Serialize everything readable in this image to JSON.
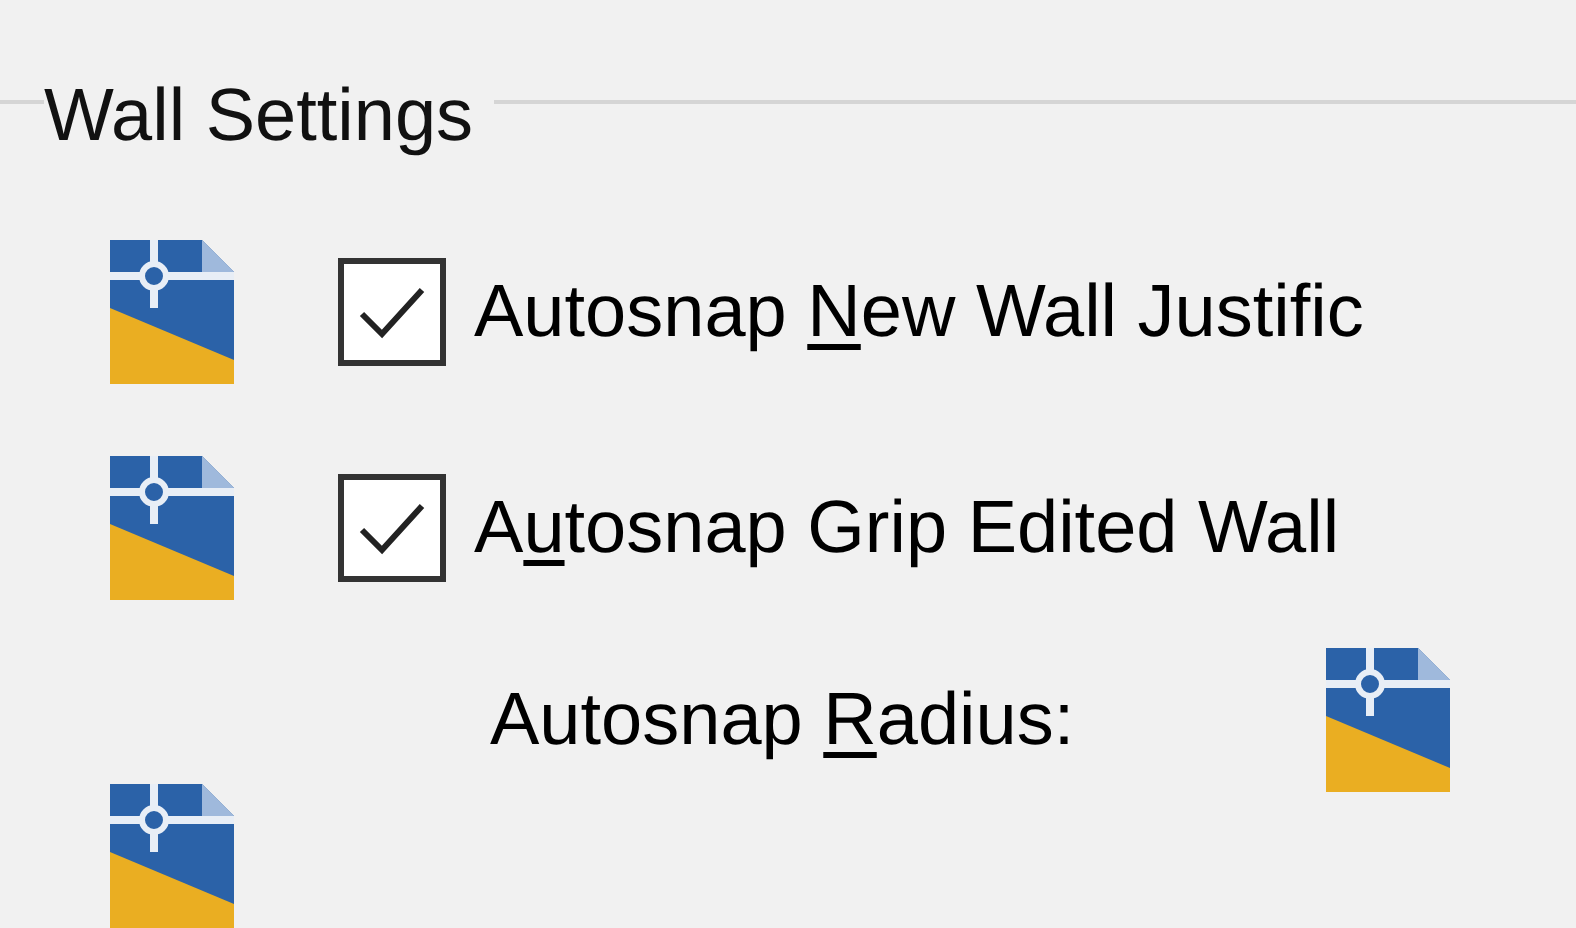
{
  "group": {
    "title": "Wall Settings"
  },
  "options": [
    {
      "label": {
        "before": "Autosnap ",
        "key": "N",
        "after": "ew Wall Justific"
      },
      "checked": true
    },
    {
      "label": {
        "before": "A",
        "key": "u",
        "after": "tosnap Grip Edited Wall"
      },
      "checked": true
    }
  ],
  "radius": {
    "label": {
      "before": "Autosnap ",
      "key": "R",
      "after": "adius:"
    }
  }
}
